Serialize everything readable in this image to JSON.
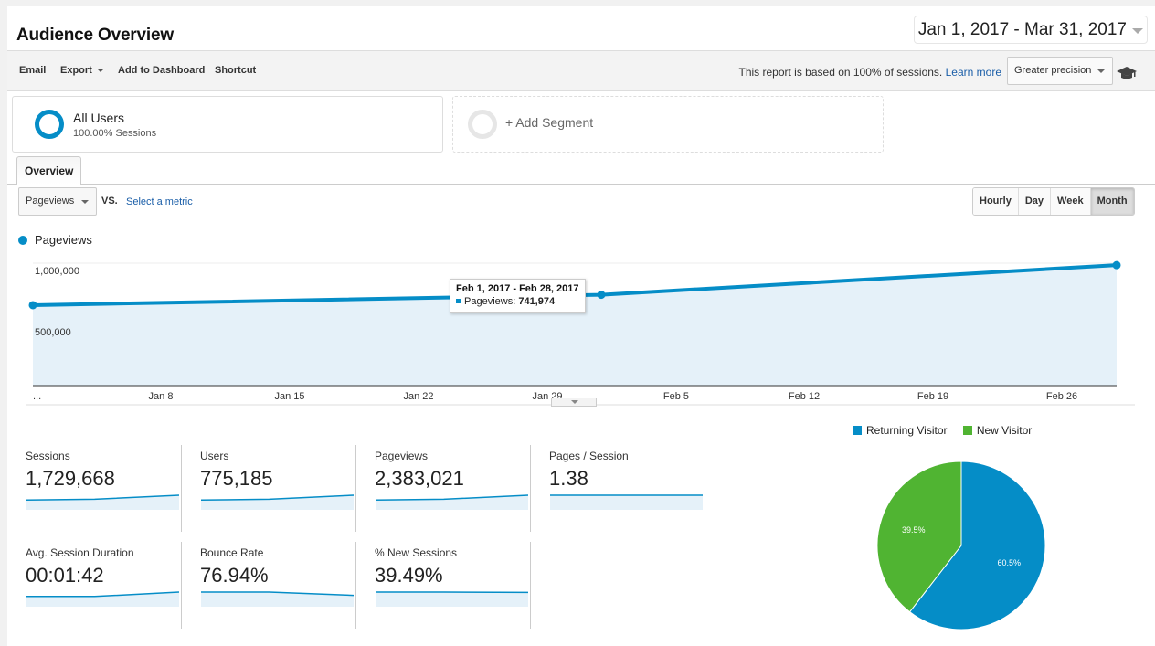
{
  "header": {
    "title": "Audience Overview",
    "date_range": "Jan 1, 2017 - Mar 31, 2017"
  },
  "toolbar": {
    "email": "Email",
    "export": "Export",
    "add_to_dashboard": "Add to Dashboard",
    "shortcut": "Shortcut",
    "sampling_text": "This report is based on 100% of sessions.",
    "learn_more": "Learn more",
    "precision": "Greater precision",
    "icon": "graduation-cap-icon"
  },
  "segments": {
    "all_users": {
      "name": "All Users",
      "sub": "100.00% Sessions"
    },
    "add_segment": "+ Add Segment"
  },
  "tabs": [
    {
      "label": "Overview",
      "active": true
    }
  ],
  "chart_controls": {
    "metric": "Pageviews",
    "vs": "VS.",
    "select_metric": "Select a metric",
    "intervals": [
      {
        "label": "Hourly",
        "active": false
      },
      {
        "label": "Day",
        "active": false
      },
      {
        "label": "Week",
        "active": false
      },
      {
        "label": "Month",
        "active": true
      }
    ]
  },
  "tooltip": {
    "title": "Feb 1, 2017 - Feb 28, 2017",
    "label": "Pageviews:",
    "value": "741,974"
  },
  "chart_data": [
    {
      "type": "area",
      "title": "",
      "legend": [
        "Pageviews"
      ],
      "series": [
        {
          "name": "Pageviews",
          "color": "#058dc7",
          "x": [
            "Jan 2017",
            "Feb 2017",
            "Mar 2017"
          ],
          "values": [
            657000,
            741974,
            984047
          ]
        }
      ],
      "x_tick_labels": [
        "...",
        "Jan 8",
        "Jan 15",
        "Jan 22",
        "Jan 29",
        "Feb 5",
        "Feb 12",
        "Feb 19",
        "Feb 26"
      ],
      "y_tick_labels": [
        "1,000,000",
        "500,000"
      ],
      "ylim": [
        0,
        1000000
      ],
      "grid": true
    },
    {
      "type": "pie",
      "legend_position": "top",
      "slices": [
        {
          "label": "Returning Visitor",
          "value": 60.5,
          "text": "60.5%",
          "color": "#058dc7"
        },
        {
          "label": "New Visitor",
          "value": 39.5,
          "text": "39.5%",
          "color": "#50b432"
        }
      ]
    }
  ],
  "scorecards": [
    {
      "label": "Sessions",
      "value": "1,729,668",
      "spark": [
        0.35,
        0.45,
        1.0
      ]
    },
    {
      "label": "Users",
      "value": "775,185",
      "spark": [
        0.35,
        0.45,
        1.0
      ]
    },
    {
      "label": "Pageviews",
      "value": "2,383,021",
      "spark": [
        0.35,
        0.45,
        1.0
      ]
    },
    {
      "label": "Pages / Session",
      "value": "1.38",
      "spark": [
        1.0,
        1.0,
        1.0
      ]
    },
    {
      "label": "Avg. Session Duration",
      "value": "00:01:42",
      "spark": [
        0.4,
        0.4,
        1.0
      ]
    },
    {
      "label": "Bounce Rate",
      "value": "76.94%",
      "spark": [
        1.0,
        1.0,
        0.55
      ]
    },
    {
      "label": "% New Sessions",
      "value": "39.49%",
      "spark": [
        1.0,
        1.0,
        0.95
      ]
    }
  ],
  "colors": {
    "accent": "#058dc7",
    "area_fill": "#e5f1f9",
    "new_visitor": "#50b432",
    "link": "#1a5ea8"
  }
}
